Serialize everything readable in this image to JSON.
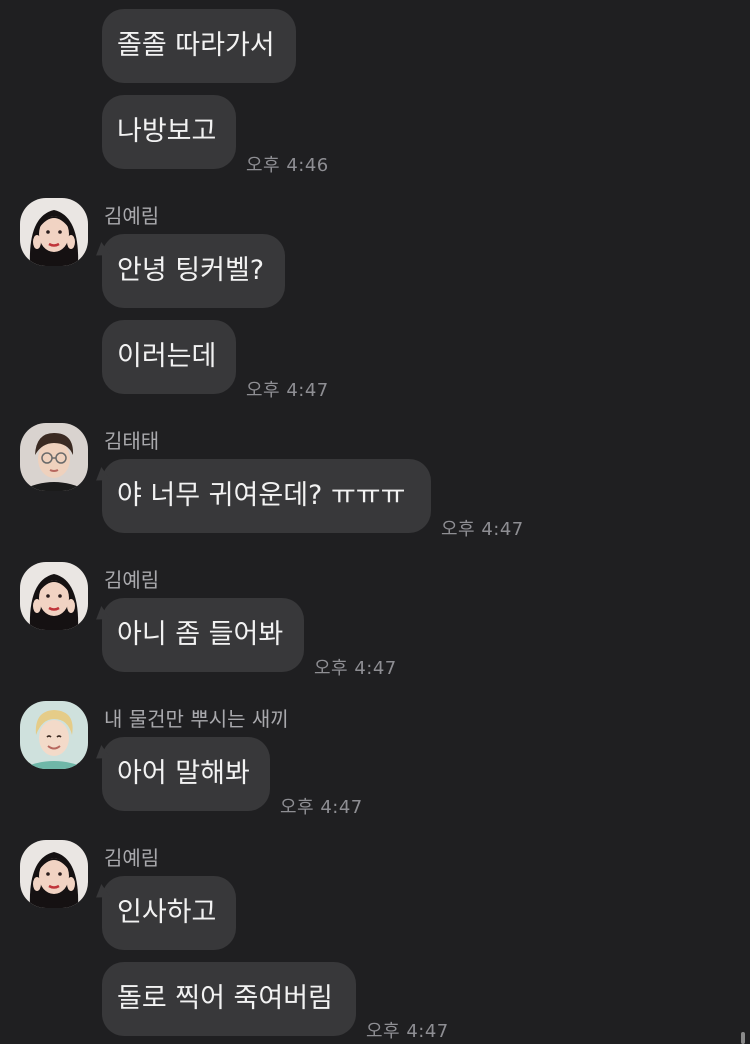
{
  "messages": {
    "m1": "졸졸 따라가서",
    "m2": "나방보고",
    "m3": "안녕 팅커벨?",
    "m4": "이러는데",
    "m5": "야 너무 귀여운데? ㅠㅠㅠ",
    "m6": "아니 좀 들어봐",
    "m7": "아어 말해봐",
    "m8": "인사하고",
    "m9": "돌로 찍어 죽여버림"
  },
  "senders": {
    "yerim": "김예림",
    "taetae": "김태태",
    "other": "내 물건만 뿌시는 새끼"
  },
  "times": {
    "t1": "오후 4:46",
    "t2": "오후 4:47",
    "t3": "오후 4:47",
    "t4": "오후 4:47",
    "t5": "오후 4:47",
    "t6": "오후 4:47"
  },
  "colors": {
    "background": "#1f1f21",
    "bubble": "#38383a",
    "text": "#f2f2f2",
    "meta": "#8e8e93"
  }
}
